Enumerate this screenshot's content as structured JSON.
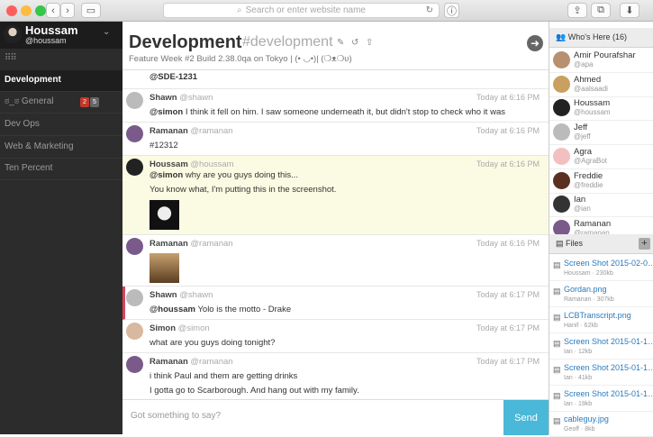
{
  "browser": {
    "url_placeholder": "Search or enter website name"
  },
  "user": {
    "name": "Houssam",
    "handle": "@houssam"
  },
  "sidebar": {
    "rooms": [
      {
        "label": "Development",
        "active": true
      },
      {
        "label": "ಠ_ಠ General",
        "badge_red": "2",
        "badge_grey": "5"
      },
      {
        "label": "Dev Ops"
      },
      {
        "label": "Web & Marketing"
      },
      {
        "label": "Ten Percent"
      }
    ]
  },
  "header": {
    "title": "Development",
    "slug": "#development",
    "topic": "Feature Week #2 Build 2.38.0qa on Tokyo | (• ◡•)| (❍ᴥ❍ʋ)"
  },
  "messages": [
    {
      "name": "",
      "handle": "",
      "time": "",
      "lines": [
        "@SDE-1231"
      ]
    },
    {
      "name": "Shawn",
      "handle": "@shawn",
      "time": "Today at 6:16 PM",
      "mention": "@simon",
      "lines": [
        " I think it fell on him. I saw someone underneath it, but didn't stop to check who it was"
      ]
    },
    {
      "name": "Ramanan",
      "handle": "@ramanan",
      "time": "Today at 6:16 PM",
      "lines": [
        "#12312"
      ]
    },
    {
      "name": "Houssam",
      "handle": "@houssam",
      "time": "Today at 6:16 PM",
      "mention": "@simon",
      "lines": [
        " why are you guys doing this...",
        "You know what, I'm putting this in the screenshot."
      ]
    },
    {
      "name": "Ramanan",
      "handle": "@ramanan",
      "time": "Today at 6:16 PM",
      "lines": []
    },
    {
      "name": "Shawn",
      "handle": "@shawn",
      "time": "Today at 6:17 PM",
      "mention": "@houssam",
      "lines": [
        " Yolo is the motto - Drake"
      ]
    },
    {
      "name": "Simon",
      "handle": "@simon",
      "time": "Today at 6:17 PM",
      "lines": [
        "what are you guys doing tonight?"
      ]
    },
    {
      "name": "Ramanan",
      "handle": "@ramanan",
      "time": "Today at 6:17 PM",
      "lines": [
        "i think Paul and them are getting drinks",
        "I gotta go to Scarborough. And hang out with my family."
      ]
    }
  ],
  "compose": {
    "placeholder": "Got something to say?",
    "send_label": "Send"
  },
  "whos_here": {
    "title": "Who's Here (16)",
    "people": [
      {
        "name": "Amir Pourafshar",
        "handle": "@apa"
      },
      {
        "name": "Ahmed",
        "handle": "@aalsaadi"
      },
      {
        "name": "Houssam",
        "handle": "@houssam"
      },
      {
        "name": "Jeff",
        "handle": "@jeff"
      },
      {
        "name": "Agra",
        "handle": "@AgraBot"
      },
      {
        "name": "Freddie",
        "handle": "@freddie"
      },
      {
        "name": "Ian",
        "handle": "@ian"
      },
      {
        "name": "Ramanan",
        "handle": "@ramanan"
      }
    ]
  },
  "files": {
    "title": "Files",
    "add_label": "+",
    "items": [
      {
        "name": "Screen Shot 2015-02-0…",
        "meta": "Houssam · 230kb"
      },
      {
        "name": "Gordan.png",
        "meta": "Ramanan · 307kb"
      },
      {
        "name": "LCBTranscript.png",
        "meta": "Hanif · 62kb"
      },
      {
        "name": "Screen Shot 2015-01-1…",
        "meta": "Ian · 12kb"
      },
      {
        "name": "Screen Shot 2015-01-1…",
        "meta": "Ian · 41kb"
      },
      {
        "name": "Screen Shot 2015-01-1…",
        "meta": "Ian · 19kb"
      },
      {
        "name": "cableguy.jpg",
        "meta": "Geoff · 8kb"
      }
    ]
  },
  "colors": {
    "sidebar": "#2c2c2c",
    "highlight": "#fbfbe3",
    "send": "#4ab8d8",
    "link": "#2a7bbd",
    "badge_red": "#c0392b"
  }
}
